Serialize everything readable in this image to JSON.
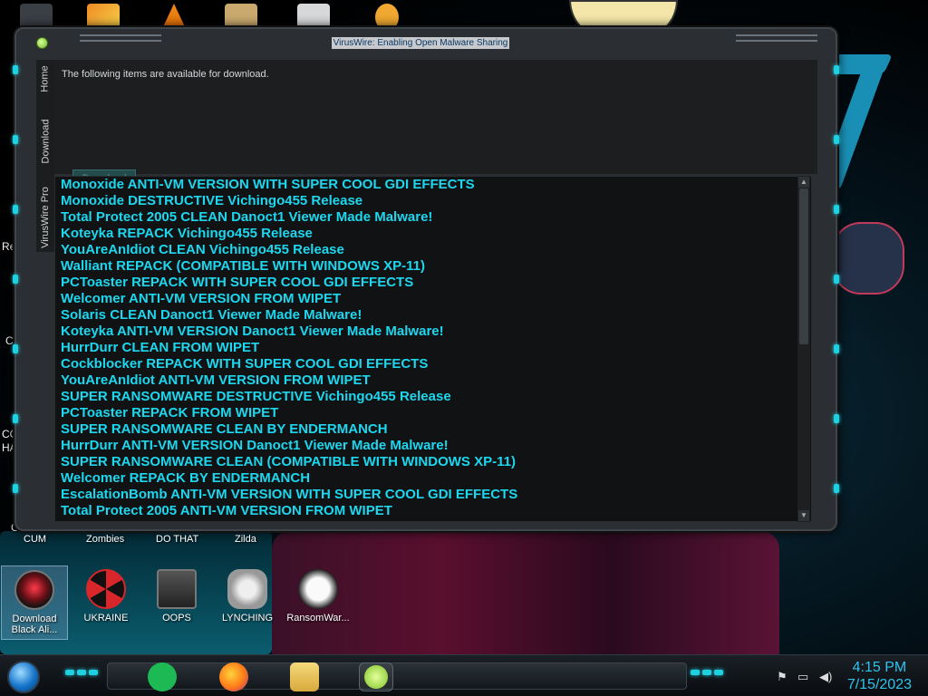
{
  "window": {
    "title": "VirusWire: Enabling Open Malware Sharing"
  },
  "tabs": [
    {
      "label": "Home"
    },
    {
      "label": "Download"
    },
    {
      "label": "VirusWire Pro"
    }
  ],
  "panel": {
    "message": "The following items are available for download.",
    "download_button": "Download"
  },
  "list_items": [
    "Monoxide ANTI-VM VERSION WITH SUPER COOL GDI EFFECTS",
    "Monoxide DESTRUCTIVE Vichingo455 Release",
    "Total Protect 2005 CLEAN Danoct1 Viewer Made Malware!",
    "Koteyka REPACK Vichingo455 Release",
    "YouAreAnIdiot CLEAN Vichingo455 Release",
    "Walliant REPACK (COMPATIBLE WITH WINDOWS XP-11)",
    "PCToaster REPACK WITH SUPER COOL GDI EFFECTS",
    "Welcomer ANTI-VM VERSION FROM WIPET",
    "Solaris CLEAN Danoct1 Viewer Made Malware!",
    "Koteyka ANTI-VM VERSION Danoct1 Viewer Made Malware!",
    "HurrDurr CLEAN FROM WIPET",
    "Cockblocker REPACK WITH SUPER COOL GDI EFFECTS",
    "YouAreAnIdiot ANTI-VM VERSION FROM WIPET",
    "SUPER RANSOMWARE DESTRUCTIVE Vichingo455 Release",
    "PCToaster REPACK FROM WIPET",
    "SUPER RANSOMWARE CLEAN BY ENDERMANCH",
    "HurrDurr ANTI-VM VERSION Danoct1 Viewer Made Malware!",
    "SUPER RANSOMWARE CLEAN (COMPATIBLE WITH WINDOWS XP-11)",
    "Welcomer REPACK BY ENDERMANCH",
    "EscalationBomb ANTI-VM VERSION WITH SUPER COOL GDI EFFECTS",
    "Total Protect 2005 ANTI-VM VERSION FROM WIPET"
  ],
  "desktop": {
    "edge_labels": [
      "Re",
      "Co",
      "CON",
      "HAT",
      "Cr"
    ],
    "row_labels": [
      "CUM",
      "Zombies",
      "DO THAT",
      "Zilda"
    ],
    "icons": [
      {
        "label": "Download Black Ali...",
        "icon": "black-orb-icon",
        "color": "#c0202a"
      },
      {
        "label": "UKRAINE",
        "icon": "radiation-icon",
        "color": "#d8262b"
      },
      {
        "label": "OOPS",
        "icon": "terminal-icon",
        "color": "#444a52"
      },
      {
        "label": "LYNCHING",
        "icon": "skull-flag-icon",
        "color": "#cfd2d4"
      },
      {
        "label": "RansomWar...",
        "icon": "skull-icon",
        "color": "#e8e8e8"
      }
    ]
  },
  "taskbar": {
    "apps": [
      {
        "name": "spotify",
        "icon": "spotify-icon",
        "color": "#1db954"
      },
      {
        "name": "firefox",
        "icon": "firefox-icon",
        "color": "#ff7a18"
      },
      {
        "name": "explorer",
        "icon": "folder-icon",
        "color": "#e8c25a"
      },
      {
        "name": "viruswire",
        "icon": "lime-icon",
        "color": "#9be23a"
      }
    ],
    "tray_icons": [
      "flag-icon",
      "network-icon",
      "volume-icon"
    ],
    "time": "4:15 PM",
    "date": "7/15/2023"
  },
  "accent": "#1fd0e0",
  "list_text_color": "#1dd7ee"
}
